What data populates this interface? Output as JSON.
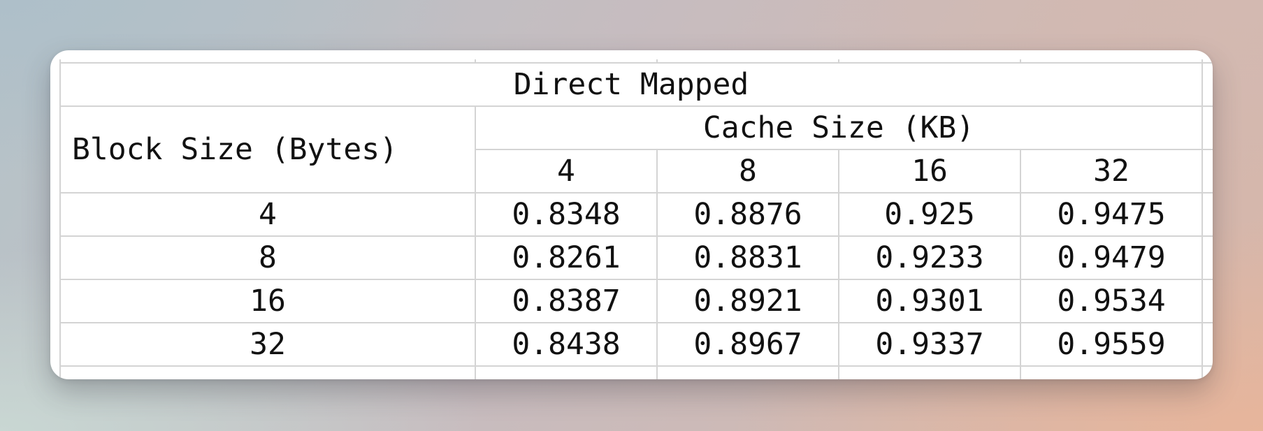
{
  "table": {
    "title": "Direct Mapped",
    "row_header_label": "Block Size (Bytes)",
    "col_group_label": "Cache Size (KB)",
    "columns": [
      "4",
      "8",
      "16",
      "32"
    ],
    "rows": [
      {
        "block_size": "4",
        "values": [
          "0.8348",
          "0.8876",
          "0.925",
          "0.9475"
        ]
      },
      {
        "block_size": "8",
        "values": [
          "0.8261",
          "0.8831",
          "0.9233",
          "0.9479"
        ]
      },
      {
        "block_size": "16",
        "values": [
          "0.8387",
          "0.8921",
          "0.9301",
          "0.9534"
        ]
      },
      {
        "block_size": "32",
        "values": [
          "0.8438",
          "0.8967",
          "0.9337",
          "0.9559"
        ]
      }
    ]
  }
}
